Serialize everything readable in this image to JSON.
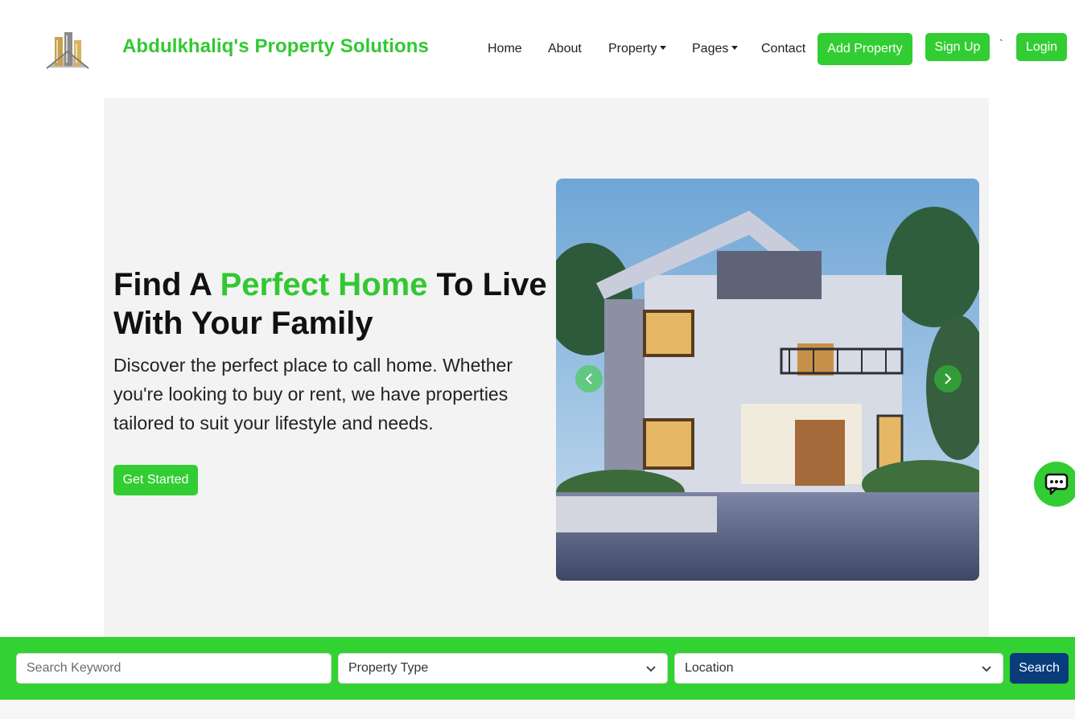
{
  "brand": {
    "name": "Abdulkhaliq's Property Solutions",
    "logo_icon": "building-logo-icon"
  },
  "nav": {
    "home": "Home",
    "about": "About",
    "property": "Property",
    "pages": "Pages",
    "contact": "Contact",
    "add_property": "Add Property",
    "sign_up": "Sign Up",
    "separator": "`",
    "login": "Login"
  },
  "hero": {
    "title_part1": "Find A ",
    "title_accent": "Perfect Home",
    "title_part2": " To Live With Your Family",
    "description": "Discover the perfect place to call home. Whether you're looking to buy or rent, we have properties tailored to suit your lifestyle and needs.",
    "cta": "Get Started"
  },
  "search": {
    "keyword_placeholder": "Search Keyword",
    "property_type": "Property Type",
    "location": "Location",
    "button": "Search"
  },
  "colors": {
    "accent": "#32cd32",
    "search_button": "#083c7a",
    "hero_bg": "#f3f3f3"
  }
}
